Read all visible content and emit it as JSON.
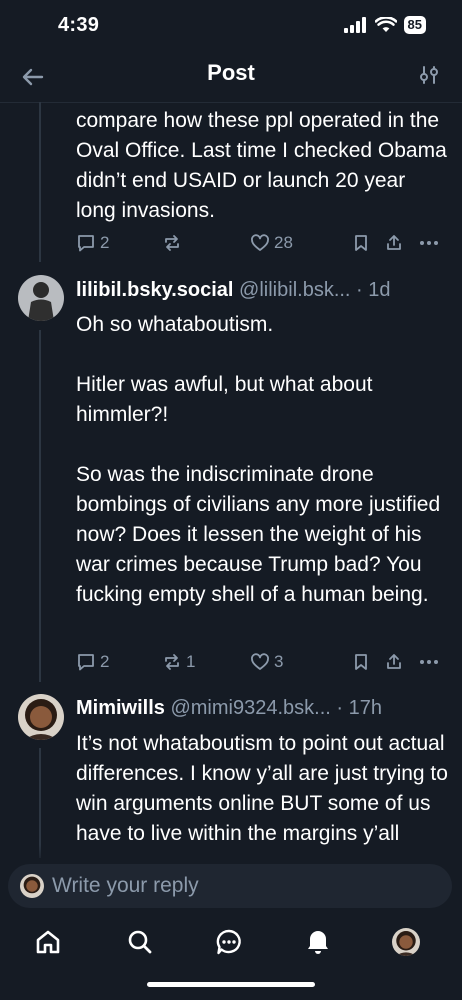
{
  "status_bar": {
    "time": "4:39",
    "battery": "85"
  },
  "nav": {
    "title": "Post"
  },
  "posts": [
    {
      "text": "compare how these ppl operated in the Oval Office. Last time I checked Obama didn’t end USAID or launch 20 year long invasions.",
      "replies": "2",
      "reposts": "",
      "likes": "28"
    },
    {
      "display_name": "lilibil.bsky.social",
      "handle": "@lilibil.bsk...",
      "age": "· 1d",
      "text": "Oh so whataboutism.\n\nHitler was awful, but what about himmler?!\n\nSo was the indiscriminate drone bombings of civilians any more justified now? Does it lessen the weight of his war crimes because Trump bad? You fucking empty shell of a human being.",
      "replies": "2",
      "reposts": "1",
      "likes": "3"
    },
    {
      "display_name": "Mimiwills",
      "handle": "@mimi9324.bsk...",
      "age": "· 17h",
      "text": "It’s not whataboutism to point out actual differences. I know y’all are just trying to win arguments online BUT some of us have to live within the margins y’all"
    }
  ],
  "composer": {
    "placeholder": "Write your reply"
  },
  "colors": {
    "background": "#151b24",
    "muted": "#8c9aab",
    "input_bg": "#1f2631"
  },
  "tabs": [
    "home-icon",
    "search-icon",
    "chat-icon",
    "bell-icon",
    "profile-avatar"
  ]
}
